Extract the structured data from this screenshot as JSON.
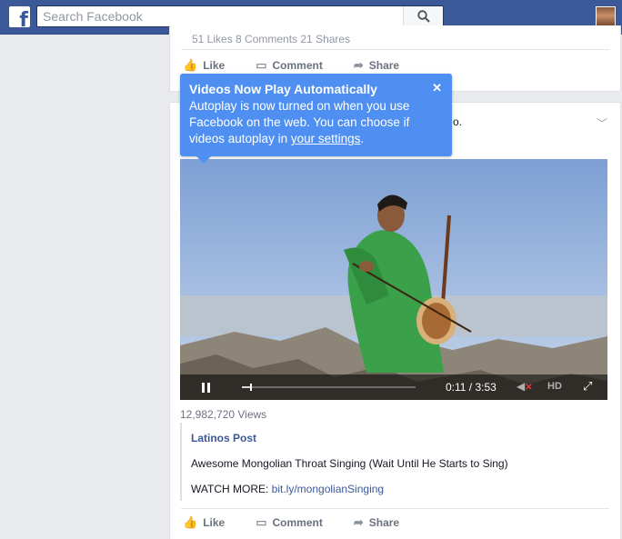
{
  "topbar": {
    "logo_glyph": "f",
    "search_placeholder": "Search Facebook"
  },
  "prev_post": {
    "stats": "51 Likes  8 Comments  21 Shares",
    "actions": [
      {
        "icon": "thumbs-up-icon",
        "label": "Like"
      },
      {
        "icon": "comment-icon",
        "label": "Comment"
      },
      {
        "icon": "share-icon",
        "label": "Share"
      }
    ]
  },
  "tooltip": {
    "title": "Videos Now Play Automatically",
    "body_prefix": "Autoplay is now turned on when you use Facebook on the web. You can choose if videos autoplay in ",
    "link": "your settings",
    "body_suffix": ".",
    "close_glyph": "✕"
  },
  "post": {
    "header_fragment": "o.",
    "video": {
      "elapsed": "0:11",
      "duration": "3:53",
      "timecode": "0:11 / 3:53",
      "progress": 0.047,
      "hd_label": "HD"
    },
    "views": "12,982,720 Views",
    "attachment": {
      "source": "Latinos Post",
      "title": "Awesome Mongolian Throat Singing (Wait Until He Starts to Sing)",
      "more_label": "WATCH MORE: ",
      "more_link": "bit.ly/mongolianSinging"
    },
    "actions": [
      {
        "icon": "thumbs-up-icon",
        "label": "Like"
      },
      {
        "icon": "comment-icon",
        "label": "Comment"
      },
      {
        "icon": "share-icon",
        "label": "Share"
      }
    ]
  },
  "colors": {
    "brand": "#3b5998",
    "tooltip": "#4e8ff1",
    "page_bg": "#e9eaed"
  }
}
